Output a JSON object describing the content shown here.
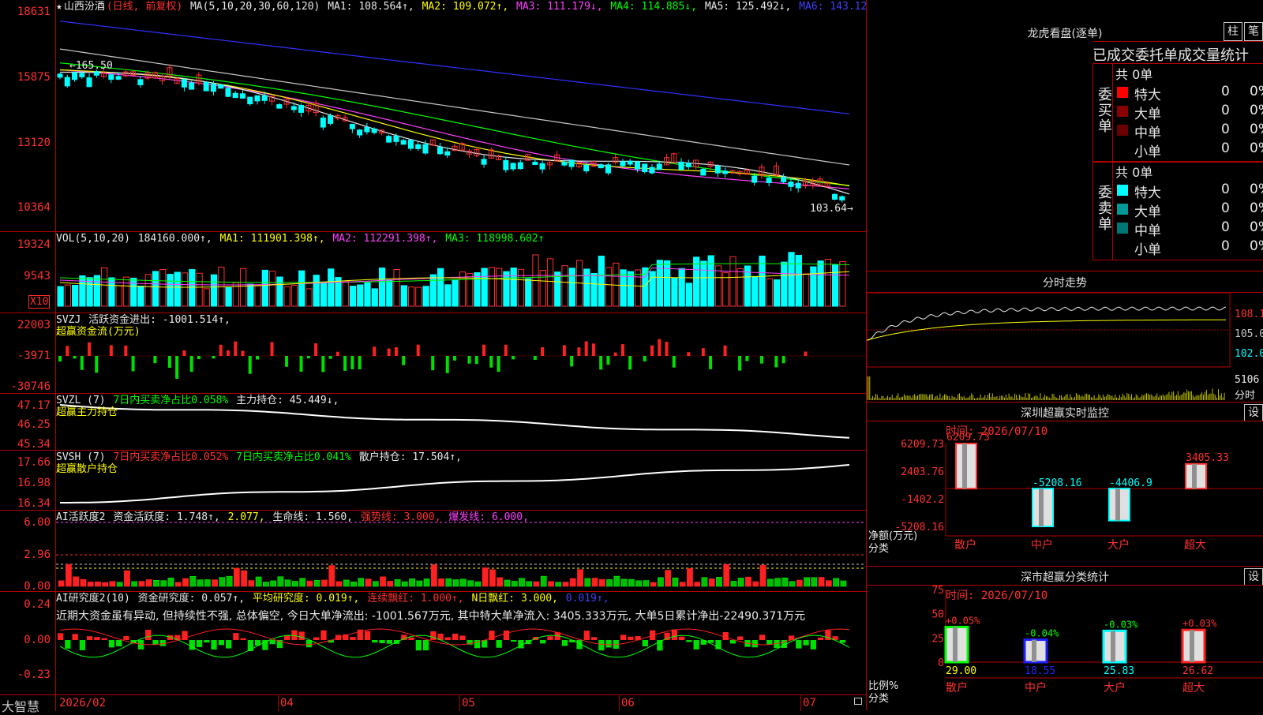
{
  "brand": "大智慧",
  "stock": {
    "name": "山西汾酒",
    "mode": "(日线, 前复权)"
  },
  "price_panel": {
    "legend": {
      "star": "★",
      "ma_def": "MA(5,10,20,30,60,120)",
      "ma1": "MA1: 108.564↑,",
      "ma2": "MA2: 109.072↑,",
      "ma3": "MA3: 111.179↓,",
      "ma4": "MA4: 114.885↓,",
      "ma5": "MA5: 125.492↓,",
      "ma6": "MA6: 143.12"
    },
    "ticks": [
      "18631",
      "15875",
      "13120",
      "10364"
    ],
    "high_marker": "165.50",
    "low_marker": "103.64→",
    "colors": {
      "ma1": "#e8e8e8",
      "ma2": "#ffff00",
      "ma3": "#ff40ff",
      "ma4": "#00ff00",
      "ma5": "#c8c8c8",
      "ma6": "#3030ff"
    }
  },
  "vol_panel": {
    "legend": {
      "def": "VOL(5,10,20)",
      "vol": "184160.000↑,",
      "ma1": "MA1: 111901.398↑,",
      "ma2": "MA2: 112291.398↑,",
      "ma3": "MA3: 118998.602↑"
    },
    "ticks": [
      "19324",
      "9543"
    ],
    "unit": "X10"
  },
  "svzj_panel": {
    "legend": {
      "def": "SVZJ",
      "active": "活跃资金进出: -1001.514↑,",
      "sub": "超赢资金流(万元)"
    },
    "ticks": [
      "22003",
      "-3971",
      "-30746"
    ]
  },
  "svzl_panel": {
    "legend": {
      "def": "SVZL (7)",
      "ratio": "7日内买卖净占比0.058%",
      "hold": "主力持仓: 45.449↓,",
      "sub": "超赢主力持仓"
    },
    "ticks": [
      "47.17",
      "46.25",
      "45.34"
    ]
  },
  "svsh_panel": {
    "legend": {
      "def": "SVSH (7)",
      "ratio1": "7日内买卖净占比0.052%",
      "ratio2": "7日内买卖净占比0.041%",
      "hold": "散户持仓: 17.504↑,",
      "sub": "超赢散户持仓"
    },
    "ticks": [
      "17.66",
      "16.98",
      "16.34"
    ]
  },
  "ai_active_panel": {
    "legend": {
      "def": "AI活跃度2",
      "active": "资金活跃度: 1.748↑,",
      "v2": "2.077,",
      "life": "生命线: 1.560,",
      "strong": "强势线: 3.000,",
      "burst": "爆发线: 6.000,"
    },
    "ticks": [
      "6.00",
      "2.96",
      "0.00"
    ]
  },
  "ai_research_panel": {
    "legend": {
      "def": "AI研究度2(10)",
      "research": "资金研究度: 0.057↑,",
      "avg": "平均研究度: 0.019↑,",
      "cont": "连续飘红: 1.000↑,",
      "nday": "N日飘红: 3.000,",
      "last": "0.019↑,"
    },
    "comment": "近期大资金虽有异动, 但持续性不强, 总体偏空, 今日大单净流出: -1001.567万元, 其中特大单净流入: 3405.333万元, 大单5日累计净出-22490.371万元",
    "ticks": [
      "0.24",
      "0.00",
      "-0.23"
    ]
  },
  "x_axis": {
    "labels": [
      "2026/02",
      "04",
      "05",
      "06",
      "07"
    ]
  },
  "side": {
    "dragon_title": "龙虎看盘(逐单)",
    "btn_bar": "柱",
    "btn_tick": "笔",
    "order_title": "已成交委托单成交量统计",
    "buy": {
      "label": "委买单",
      "total": "共 0单",
      "rows": [
        {
          "name": "特大",
          "vol": "0",
          "pct": "0%",
          "color": "#ff0000"
        },
        {
          "name": "大单",
          "vol": "0",
          "pct": "0%",
          "color": "#8b0000"
        },
        {
          "name": "中单",
          "vol": "0",
          "pct": "0%",
          "color": "#6a0000"
        },
        {
          "name": "小单",
          "vol": "0",
          "pct": "0%",
          "color": "#000000"
        }
      ]
    },
    "sell": {
      "label": "委卖单",
      "total": "共 0单",
      "rows": [
        {
          "name": "特大",
          "vol": "0",
          "pct": "0%",
          "color": "#00ffff"
        },
        {
          "name": "大单",
          "vol": "0",
          "pct": "0%",
          "color": "#009999"
        },
        {
          "name": "中单",
          "vol": "0",
          "pct": "0%",
          "color": "#007777"
        },
        {
          "name": "小单",
          "vol": "0",
          "pct": "0%",
          "color": "#000000"
        }
      ]
    },
    "intraday": {
      "title": "分时走势",
      "ticks": [
        "108.1",
        "105.0",
        "102.0"
      ],
      "vol_tick": "5106",
      "vol_unit": "分时"
    },
    "monitor": {
      "title": "深圳超赢实时监控",
      "btn": "设",
      "time": "时间: 2026/07/10",
      "ticks": [
        "6209.73",
        "2403.76",
        "-1402.2",
        "-5208.16"
      ],
      "ylabel": "净额(万元)",
      "xlabel": "分类",
      "bars": [
        {
          "cat": "散户",
          "value": 6209.73,
          "label": "6209.73",
          "label_color": "#ff3030"
        },
        {
          "cat": "中户",
          "value": -5208.16,
          "label": "-5208.16",
          "label_color": "#00ffff"
        },
        {
          "cat": "大户",
          "value": -4406.9,
          "label": "-4406.9",
          "label_color": "#00ffff"
        },
        {
          "cat": "超大",
          "value": 3405.33,
          "label": "3405.33",
          "label_color": "#ff3030"
        }
      ]
    },
    "classify": {
      "title": "深市超赢分类统计",
      "btn": "设",
      "time": "时间: 2026/07/10",
      "ticks": [
        "75",
        "50",
        "25",
        "0"
      ],
      "ylabel": "比例%",
      "xlabel": "分类",
      "bars": [
        {
          "cat": "散户",
          "value": 29.0,
          "label": "29.00",
          "change": "+0.05%",
          "color": "#00ff00",
          "label_color": "#ffff00",
          "change_color": "#ff3030"
        },
        {
          "cat": "中户",
          "value": 18.55,
          "label": "18.55",
          "change": "-0.04%",
          "color": "#2020ff",
          "label_color": "#2020ff",
          "change_color": "#00ff00"
        },
        {
          "cat": "大户",
          "value": 25.83,
          "label": "25.83",
          "change": "-0.03%",
          "color": "#00ffff",
          "label_color": "#00ffff",
          "change_color": "#00ff00"
        },
        {
          "cat": "超大",
          "value": 26.62,
          "label": "26.62",
          "change": "+0.03%",
          "color": "#ff2020",
          "label_color": "#ff3030",
          "change_color": "#ff3030"
        }
      ]
    }
  }
}
